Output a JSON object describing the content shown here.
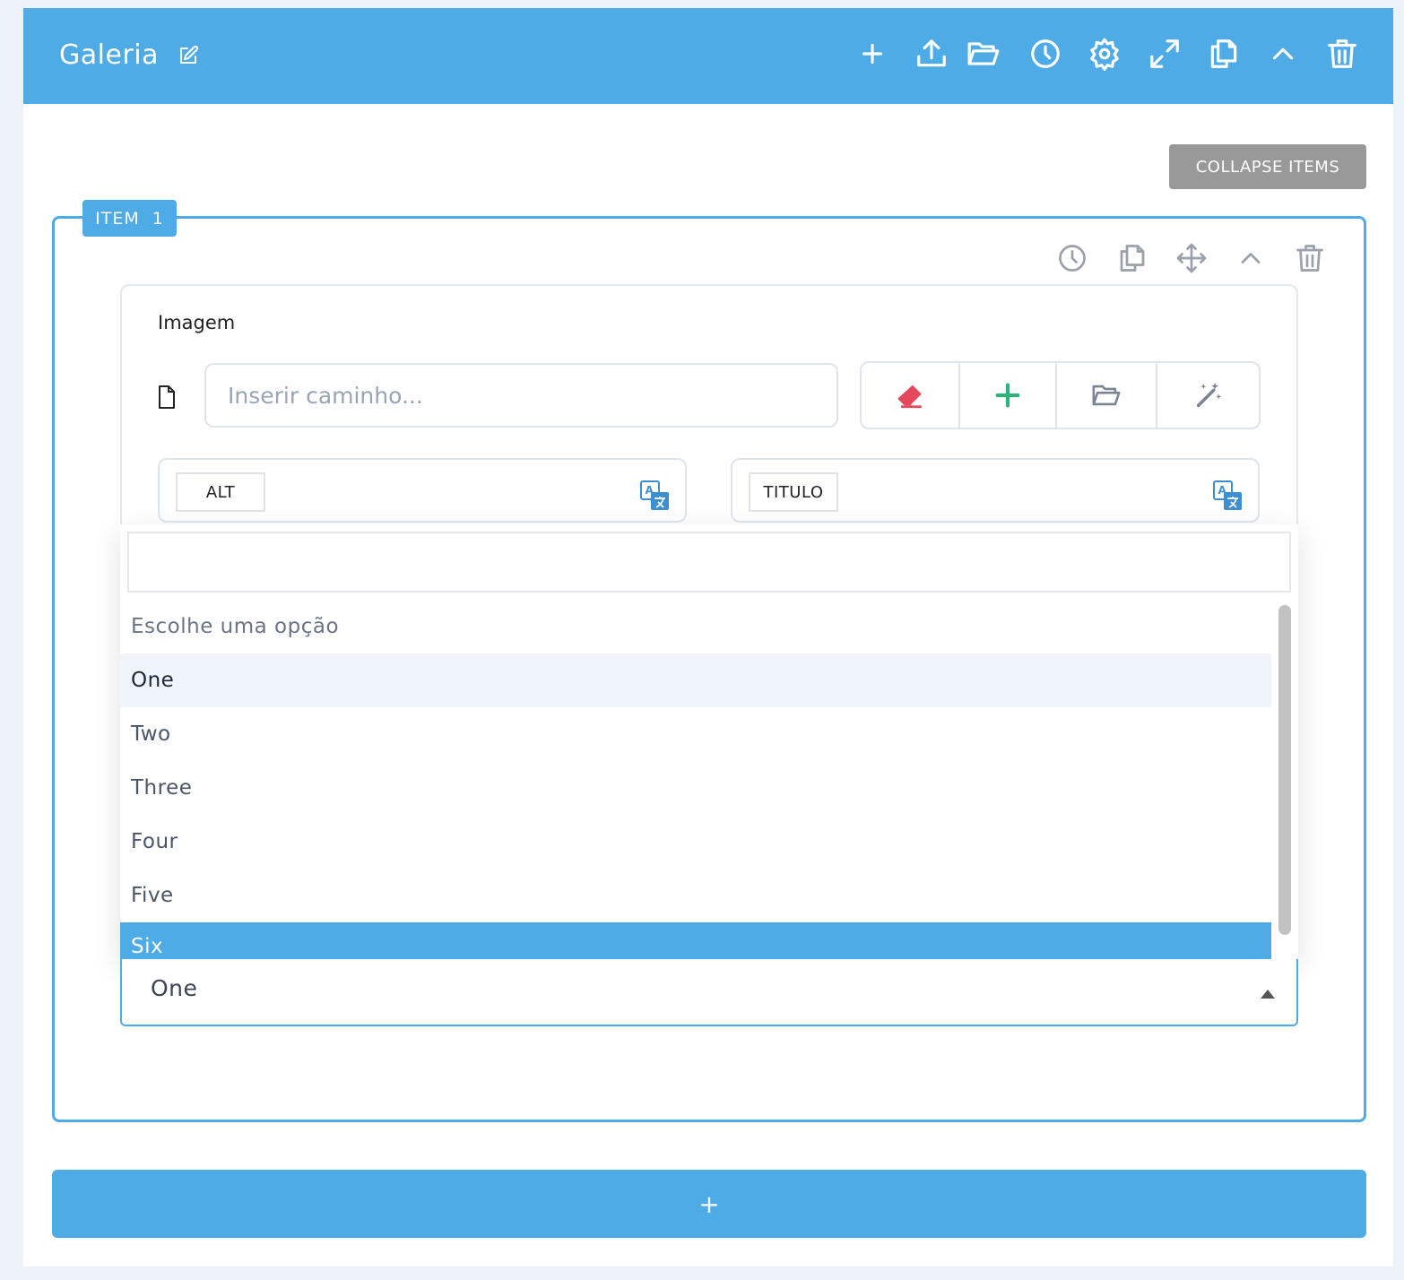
{
  "header": {
    "title": "Galeria",
    "icons": [
      "edit-icon",
      "plus-icon",
      "upload-icon",
      "folder-open-icon",
      "history-icon",
      "settings-icon",
      "expand-icon",
      "copy-icon",
      "chevron-up-icon",
      "trash-icon"
    ]
  },
  "toolbar": {
    "collapse_label": "COLLAPSE ITEMS"
  },
  "item": {
    "badge": "ITEM  1",
    "icons": [
      "history-icon",
      "copy-icon",
      "move-icon",
      "chevron-up-icon",
      "trash-icon"
    ],
    "image_label": "Imagem",
    "path_placeholder": "Inserir caminho...",
    "path_buttons": [
      "eraser-icon",
      "plus-icon",
      "folder-open-icon",
      "magic-wand-icon"
    ],
    "alt_label": "ALT",
    "title_label": "TITULO"
  },
  "dropdown": {
    "search_value": "",
    "options": [
      "Escolhe uma opção",
      "One",
      "Two",
      "Three",
      "Four",
      "Five",
      "Six"
    ],
    "hovered": "One",
    "highlighted": "Six"
  },
  "select": {
    "value": "One"
  },
  "add_button": {
    "label": "+"
  },
  "colors": {
    "accent": "#4eabe6",
    "collapse_button": "#999999",
    "eraser": "#e5475c",
    "add_green": "#2fb37a"
  }
}
